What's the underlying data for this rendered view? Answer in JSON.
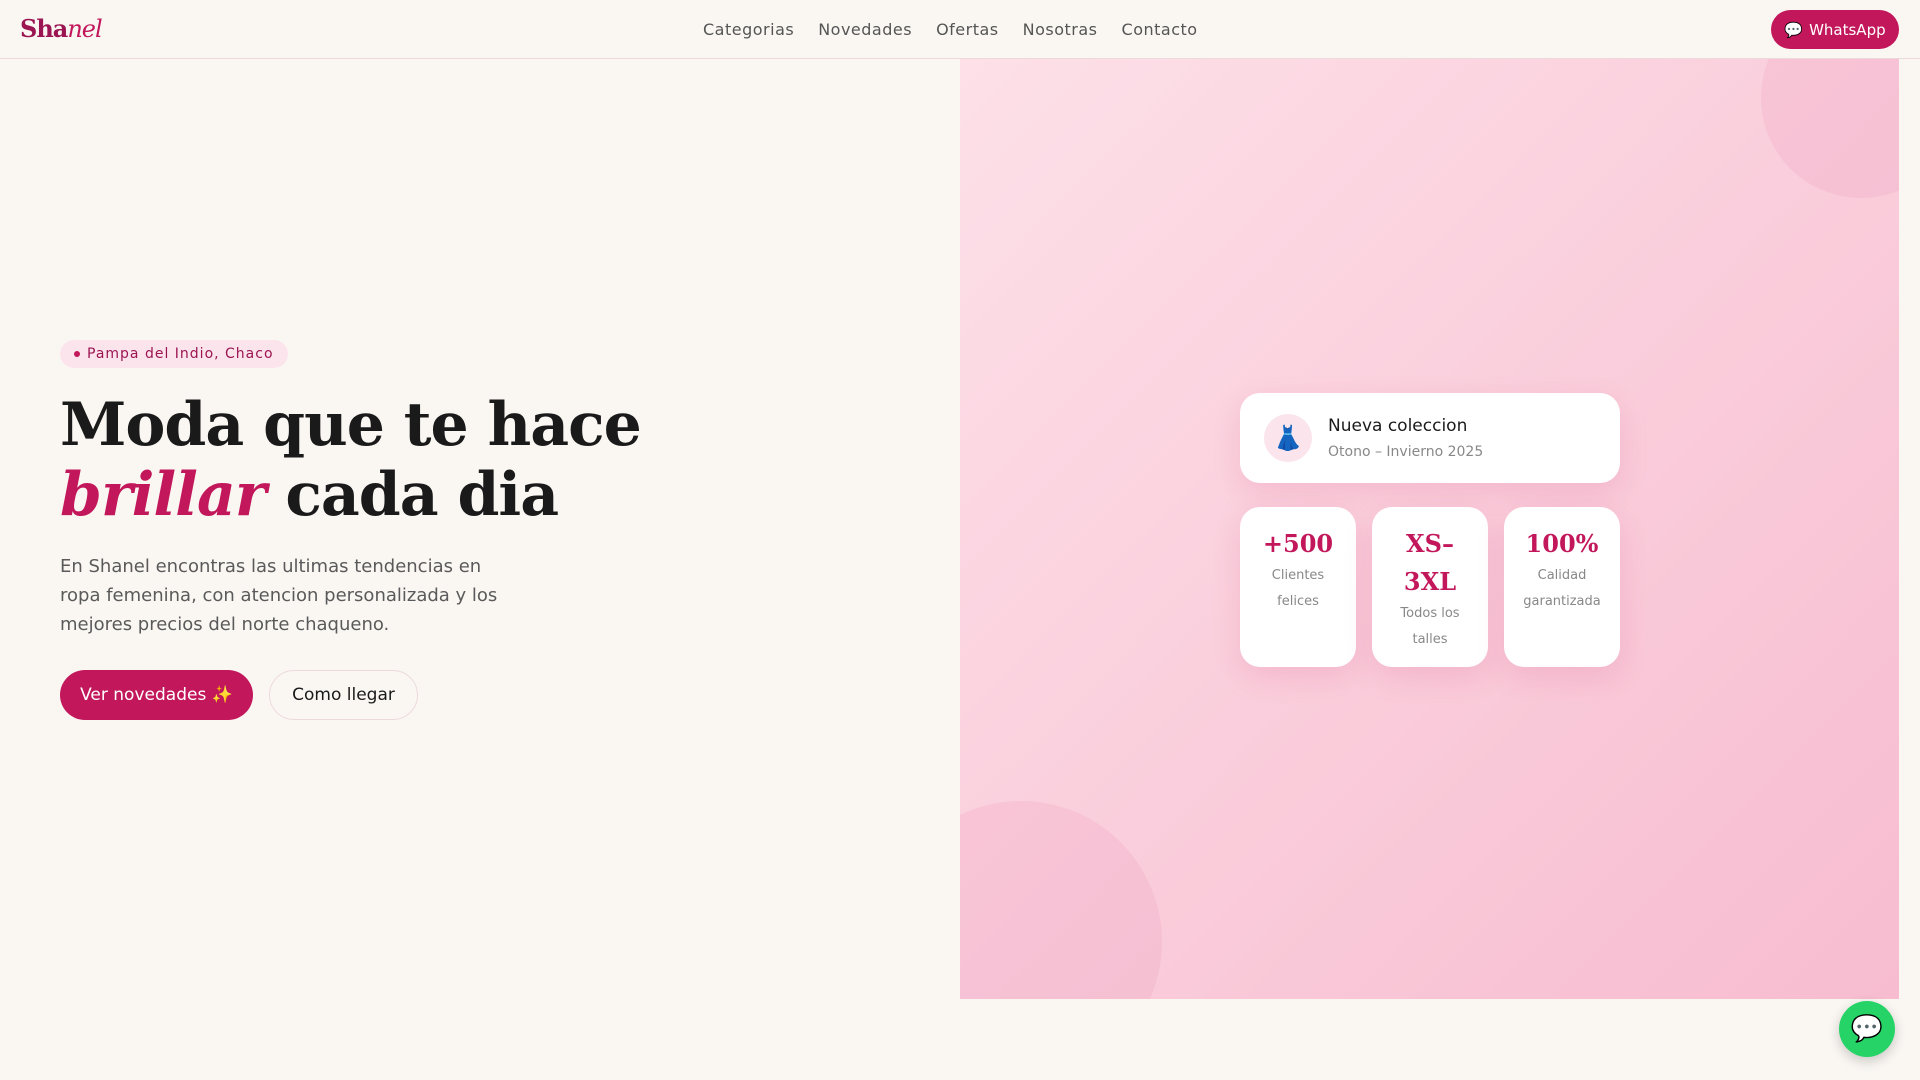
{
  "nav": {
    "logo_a": "Sha",
    "logo_b": "nel",
    "links": [
      "Categorias",
      "Novedades",
      "Ofertas",
      "Nosotras",
      "Contacto"
    ],
    "whatsapp": "WhatsApp"
  },
  "hero": {
    "location": "Pampa del Indio, Chaco",
    "title_1": "Moda que te hace",
    "title_accent": "brillar",
    "title_2": "cada dia",
    "description": "En Shanel encontras las ultimas tendencias en ropa femenina, con atencion personalizada y los mejores precios del norte chaqueno.",
    "primary_button": "Ver novedades ✨",
    "secondary_button": "Como llegar"
  },
  "collection": {
    "title": "Nueva coleccion",
    "subtitle": "Otono – Invierno 2025"
  },
  "stats": [
    {
      "value": "+500",
      "label": "Clientes felices"
    },
    {
      "value": "XS–3XL",
      "label": "Todos los talles"
    },
    {
      "value": "100%",
      "label": "Calidad garantizada"
    }
  ],
  "colors": {
    "accent": "#c2185b",
    "whatsapp": "#25d366",
    "background": "#faf7f3"
  }
}
